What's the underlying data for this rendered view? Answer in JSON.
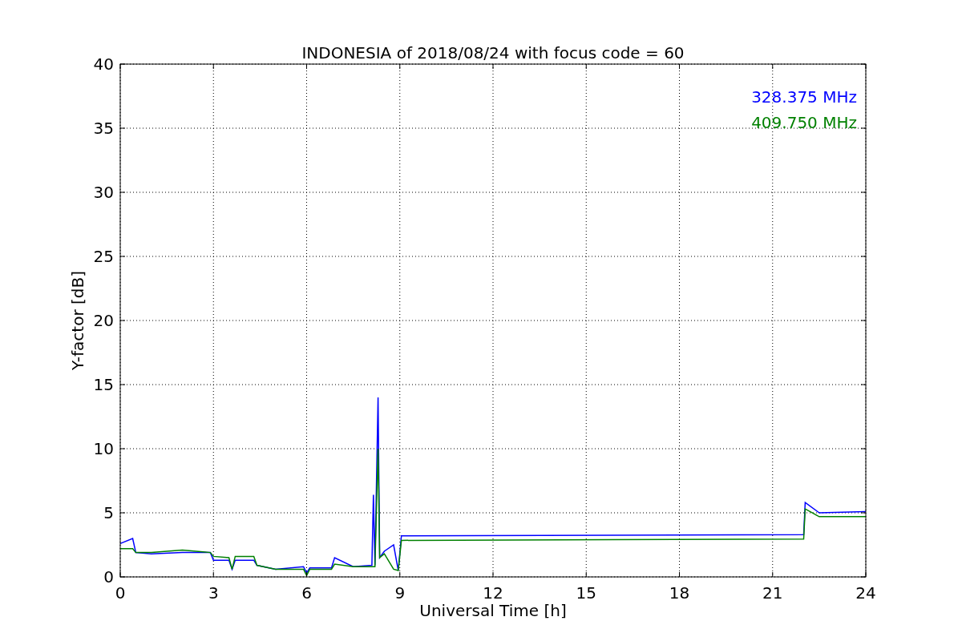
{
  "chart_data": {
    "type": "line",
    "title": "INDONESIA of 2018/08/24 with focus code = 60",
    "xlabel": "Universal Time [h]",
    "ylabel": "Y-factor [dB]",
    "x": [
      0,
      0.4,
      0.5,
      1,
      2,
      2.9,
      3,
      3.5,
      3.6,
      3.7,
      4.3,
      4.4,
      5,
      5.9,
      6,
      6.1,
      6.8,
      6.9,
      7.5,
      8.1,
      8.15,
      8.2,
      8.3,
      8.35,
      8.5,
      8.8,
      8.95,
      9.05,
      22,
      22.05,
      22.5,
      24
    ],
    "series": [
      {
        "name": "328.375 MHz",
        "color": "#0000ff",
        "values": [
          2.6,
          3.0,
          1.9,
          1.8,
          1.9,
          1.9,
          1.3,
          1.3,
          0.6,
          1.3,
          1.3,
          0.9,
          0.6,
          0.8,
          0.3,
          0.7,
          0.7,
          1.5,
          0.8,
          0.9,
          6.4,
          0.9,
          14.0,
          1.5,
          2.0,
          2.5,
          0.5,
          3.2,
          3.3,
          5.8,
          5.0,
          5.1
        ]
      },
      {
        "name": "409.750 MHz",
        "color": "#008000",
        "values": [
          2.2,
          2.2,
          1.9,
          1.9,
          2.1,
          1.9,
          1.6,
          1.5,
          0.6,
          1.6,
          1.6,
          0.9,
          0.6,
          0.6,
          0.1,
          0.6,
          0.6,
          1.0,
          0.8,
          0.8,
          0.8,
          0.8,
          10.0,
          1.5,
          1.8,
          0.6,
          0.5,
          2.85,
          2.95,
          5.3,
          4.7,
          4.7
        ]
      }
    ],
    "grid": true,
    "xlim": [
      0,
      24
    ],
    "ylim": [
      0,
      40
    ],
    "xticks": [
      0,
      3,
      6,
      9,
      12,
      15,
      18,
      21,
      24
    ],
    "yticks": [
      0,
      5,
      10,
      15,
      20,
      25,
      30,
      35,
      40
    ]
  }
}
